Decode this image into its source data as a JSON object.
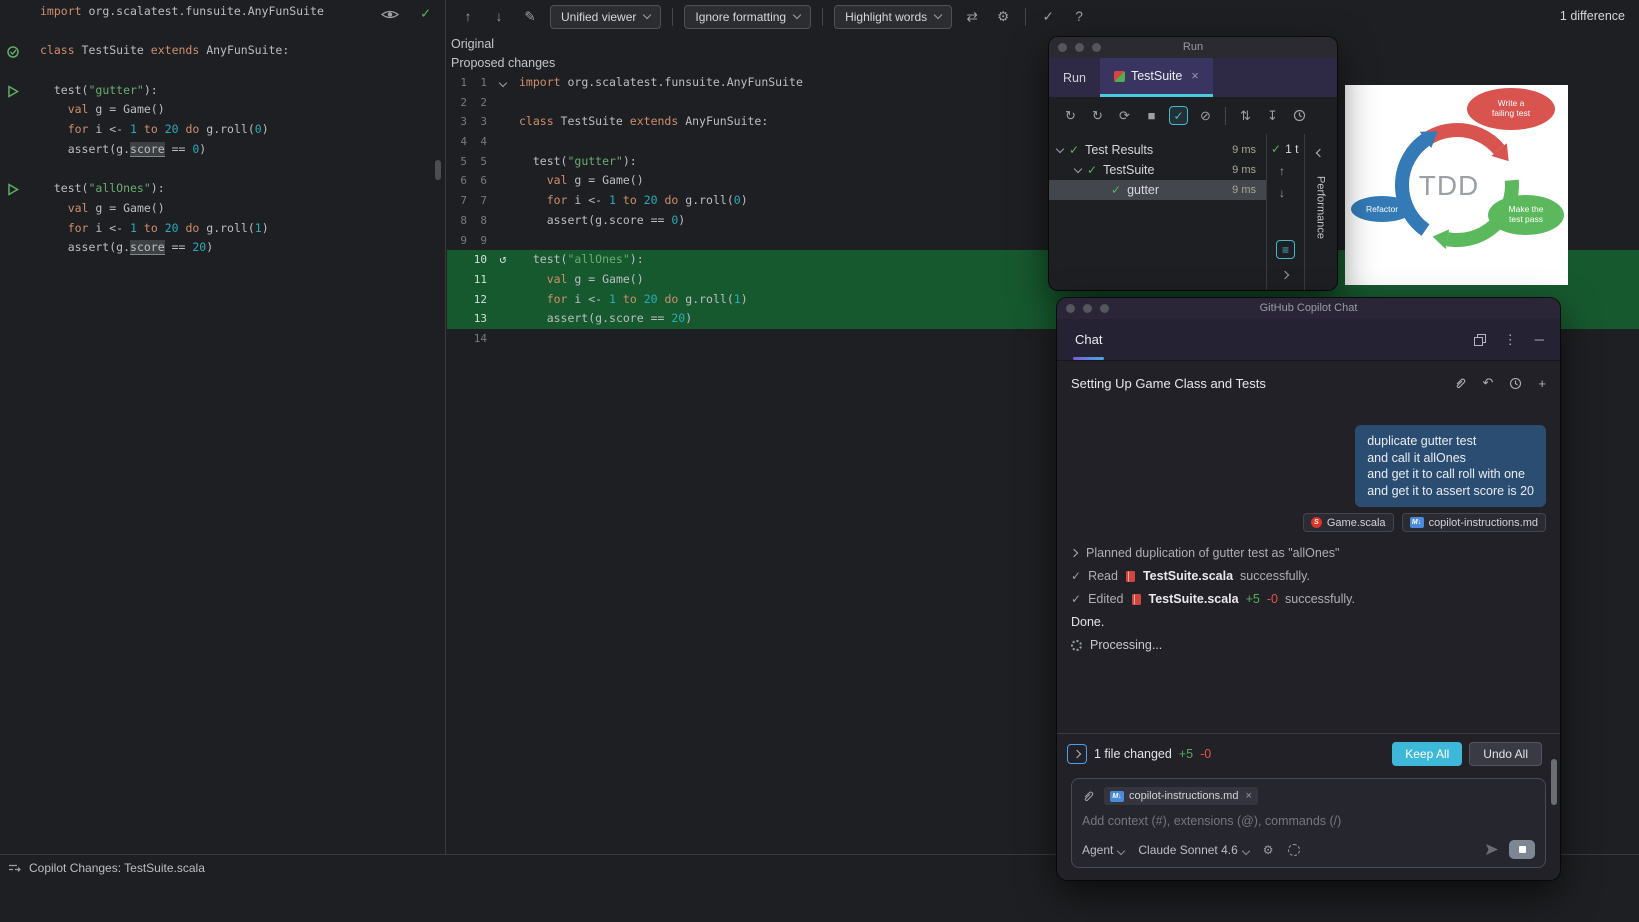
{
  "status_bar": {
    "text": "Copilot Changes: TestSuite.scala"
  },
  "diff_toolbar": {
    "viewer_label": "Unified viewer",
    "ignore_label": "Ignore formatting",
    "highlight_label": "Highlight words",
    "difference_count": "1 difference"
  },
  "diff": {
    "original_label": "Original",
    "proposed_label": "Proposed changes",
    "rows": [
      {
        "old": "1",
        "new": "1",
        "line": 0,
        "fold": true
      },
      {
        "old": "2",
        "new": "2",
        "line": 1
      },
      {
        "old": "3",
        "new": "3",
        "line": 2
      },
      {
        "old": "4",
        "new": "4",
        "line": 3
      },
      {
        "old": "5",
        "new": "5",
        "line": 4
      },
      {
        "old": "6",
        "new": "6",
        "line": 5
      },
      {
        "old": "7",
        "new": "7",
        "line": 6
      },
      {
        "old": "8",
        "new": "8",
        "line": 7
      },
      {
        "old": "9",
        "new": "9",
        "line": 8
      },
      {
        "old": "",
        "new": "10",
        "line": 9,
        "added": true,
        "revert": true
      },
      {
        "old": "",
        "new": "11",
        "line": 10,
        "added": true
      },
      {
        "old": "",
        "new": "12",
        "line": 11,
        "added": true
      },
      {
        "old": "",
        "new": "13",
        "line": 12,
        "added": true
      },
      {
        "old": "",
        "new": "14",
        "line": 13
      }
    ]
  },
  "code": {
    "lines": [
      {
        "segs": [
          [
            "k",
            "import"
          ],
          [
            "p",
            " org.scalatest.funsuite.AnyFunSuite"
          ]
        ]
      },
      {
        "segs": []
      },
      {
        "segs": [
          [
            "k",
            "class"
          ],
          [
            "p",
            " TestSuite "
          ],
          [
            "k",
            "extends"
          ],
          [
            "p",
            " AnyFunSuite:"
          ]
        ]
      },
      {
        "segs": []
      },
      {
        "segs": [
          [
            "p",
            "  test("
          ],
          [
            "s",
            "\"gutter\""
          ],
          [
            "p",
            "):"
          ]
        ]
      },
      {
        "segs": [
          [
            "p",
            "    "
          ],
          [
            "k",
            "val"
          ],
          [
            "p",
            " g = Game()"
          ]
        ]
      },
      {
        "segs": [
          [
            "p",
            "    "
          ],
          [
            "k",
            "for"
          ],
          [
            "p",
            " i <- "
          ],
          [
            "n",
            "1"
          ],
          [
            "p",
            " "
          ],
          [
            "k",
            "to"
          ],
          [
            "p",
            " "
          ],
          [
            "n",
            "20"
          ],
          [
            "p",
            " "
          ],
          [
            "k",
            "do"
          ],
          [
            "p",
            " g.roll("
          ],
          [
            "n",
            "0"
          ],
          [
            "p",
            ")"
          ]
        ]
      },
      {
        "segs": [
          [
            "p",
            "    assert(g."
          ],
          [
            "u",
            "score"
          ],
          [
            "p",
            " == "
          ],
          [
            "n",
            "0"
          ],
          [
            "p",
            ")"
          ]
        ]
      },
      {
        "segs": []
      },
      {
        "segs": [
          [
            "p",
            "  test("
          ],
          [
            "s",
            "\"allOnes\""
          ],
          [
            "p",
            "):"
          ]
        ]
      },
      {
        "segs": [
          [
            "p",
            "    "
          ],
          [
            "k",
            "val"
          ],
          [
            "p",
            " g = Game()"
          ]
        ]
      },
      {
        "segs": [
          [
            "p",
            "    "
          ],
          [
            "k",
            "for"
          ],
          [
            "p",
            " i <- "
          ],
          [
            "n",
            "1"
          ],
          [
            "p",
            " "
          ],
          [
            "k",
            "to"
          ],
          [
            "p",
            " "
          ],
          [
            "n",
            "20"
          ],
          [
            "p",
            " "
          ],
          [
            "k",
            "do"
          ],
          [
            "p",
            " g.roll("
          ],
          [
            "n",
            "1"
          ],
          [
            "p",
            ")"
          ]
        ]
      },
      {
        "segs": [
          [
            "p",
            "    assert(g."
          ],
          [
            "u",
            "score"
          ],
          [
            "p",
            " == "
          ],
          [
            "n",
            "20"
          ],
          [
            "p",
            ")"
          ]
        ]
      },
      {
        "segs": []
      }
    ]
  },
  "run_window": {
    "window_title": "Run",
    "tab_run": "Run",
    "tab_testsuite": "TestSuite",
    "tree": [
      {
        "label": "Test Results",
        "time": "9 ms"
      },
      {
        "label": "TestSuite",
        "time": "9 ms"
      },
      {
        "label": "gutter",
        "time": "9 ms"
      }
    ],
    "passed_summary": "1 t",
    "performance_label": "Performance"
  },
  "tdd": {
    "center_label": "TDD",
    "label_top": "Write a failing test",
    "label_right": "Make the test pass",
    "label_left": "Refactor"
  },
  "chat": {
    "window_title": "GitHub Copilot Chat",
    "tab_label": "Chat",
    "session_title": "Setting Up Game Class and Tests",
    "user_message": "duplicate gutter test\nand call it allOnes\nand get it to call roll with one\nand get it to assert score is 20",
    "attachment_game": "Game.scala",
    "attachment_md": "copilot-instructions.md",
    "planned_step": "Planned duplication of gutter test as \"allOnes\"",
    "read_action": "Read",
    "read_file": "TestSuite.scala",
    "read_suffix": "successfully.",
    "edited_action": "Edited",
    "edited_file": "TestSuite.scala",
    "edited_plus": "+5",
    "edited_minus": "-0",
    "edited_suffix": "successfully.",
    "done_text": "Done.",
    "processing_text": "Processing...",
    "files_changed_text": "1 file changed",
    "files_plus": "+5",
    "files_minus": "-0",
    "keep_all_label": "Keep All",
    "undo_all_label": "Undo All",
    "input_chip_label": "copilot-instructions.md",
    "input_placeholder": "Add context (#), extensions (@), commands (/)",
    "agent_label": "Agent",
    "model_label": "Claude Sonnet 4.6"
  },
  "colors": {
    "accent_cyan": "#49ccdd",
    "added_green_bg": "#17592f",
    "keyword": "#cf8e6d",
    "string": "#6aab73",
    "number": "#2aacb8",
    "tdd_red": "#d9534f",
    "tdd_green": "#5cb85c",
    "tdd_blue": "#337ab7"
  }
}
